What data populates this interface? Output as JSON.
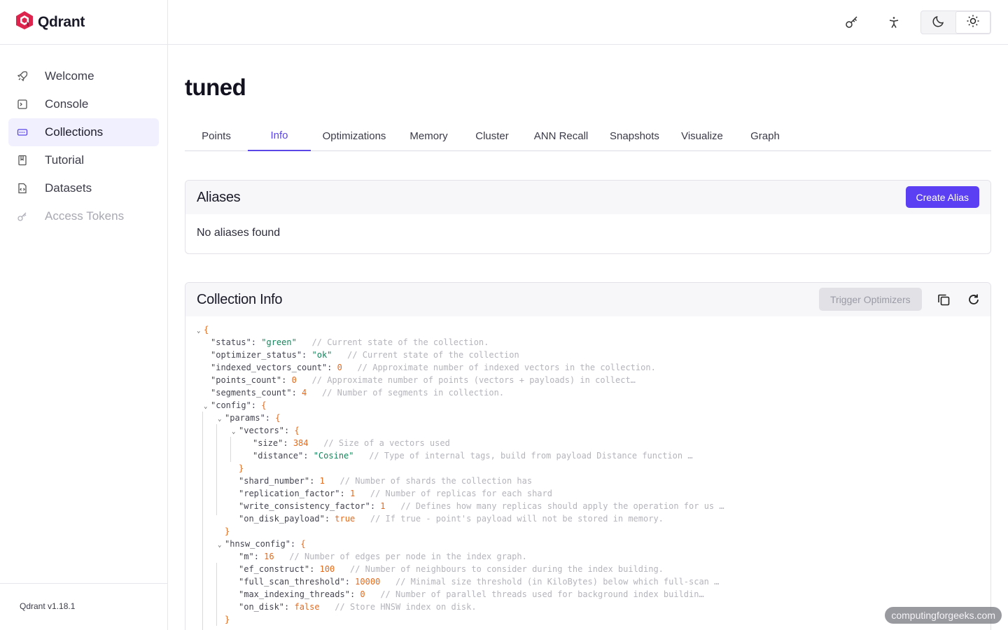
{
  "brand": {
    "name": "Qdrant",
    "accent": "#dc244c"
  },
  "sidebar": {
    "items": [
      {
        "label": "Welcome",
        "icon": "rocket-icon"
      },
      {
        "label": "Console",
        "icon": "terminal-icon"
      },
      {
        "label": "Collections",
        "icon": "collections-icon",
        "active": true
      },
      {
        "label": "Tutorial",
        "icon": "book-icon"
      },
      {
        "label": "Datasets",
        "icon": "dataset-file-icon"
      },
      {
        "label": "Access Tokens",
        "icon": "key-icon",
        "disabled": true
      }
    ],
    "version": "Qdrant v1.18.1"
  },
  "topbar": {
    "icons": [
      "key-icon",
      "accessibility-icon"
    ],
    "theme": {
      "options": [
        "moon-icon",
        "sun-icon"
      ],
      "selected": "light"
    }
  },
  "page": {
    "title": "tuned"
  },
  "tabs": [
    {
      "label": "Points"
    },
    {
      "label": "Info",
      "active": true
    },
    {
      "label": "Optimizations"
    },
    {
      "label": "Memory"
    },
    {
      "label": "Cluster"
    },
    {
      "label": "ANN Recall"
    },
    {
      "label": "Snapshots"
    },
    {
      "label": "Visualize"
    },
    {
      "label": "Graph"
    }
  ],
  "aliases": {
    "title": "Aliases",
    "create_label": "Create Alias",
    "empty_text": "No aliases found"
  },
  "collection_info": {
    "title": "Collection Info",
    "trigger_label": "Trigger Optimizers",
    "json_lines": [
      {
        "depth": 0,
        "caret": true,
        "open": "{"
      },
      {
        "depth": 1,
        "key": "\"status\"",
        "value": "\"green\"",
        "type": "string",
        "comment": "// Current state of the collection."
      },
      {
        "depth": 1,
        "key": "\"optimizer_status\"",
        "value": "\"ok\"",
        "type": "string",
        "comment": "// Current state of the collection"
      },
      {
        "depth": 1,
        "key": "\"indexed_vectors_count\"",
        "value": "0",
        "type": "number",
        "comment": "// Approximate number of indexed vectors in the collection."
      },
      {
        "depth": 1,
        "key": "\"points_count\"",
        "value": "0",
        "type": "number",
        "comment": "// Approximate number of points (vectors + payloads) in collect…"
      },
      {
        "depth": 1,
        "key": "\"segments_count\"",
        "value": "4",
        "type": "number",
        "comment": "// Number of segments in collection."
      },
      {
        "depth": 1,
        "caret": true,
        "key": "\"config\"",
        "open": "{"
      },
      {
        "depth": 2,
        "caret": true,
        "key": "\"params\"",
        "open": "{"
      },
      {
        "depth": 3,
        "caret": true,
        "key": "\"vectors\"",
        "open": "{"
      },
      {
        "depth": 4,
        "key": "\"size\"",
        "value": "384",
        "type": "number",
        "comment": "// Size of a vectors used"
      },
      {
        "depth": 4,
        "key": "\"distance\"",
        "value": "\"Cosine\"",
        "type": "string",
        "comment": "// Type of internal tags, build from payload Distance function …"
      },
      {
        "depth": 3,
        "close": "}"
      },
      {
        "depth": 3,
        "key": "\"shard_number\"",
        "value": "1",
        "type": "number",
        "comment": "// Number of shards the collection has"
      },
      {
        "depth": 3,
        "key": "\"replication_factor\"",
        "value": "1",
        "type": "number",
        "comment": "// Number of replicas for each shard"
      },
      {
        "depth": 3,
        "key": "\"write_consistency_factor\"",
        "value": "1",
        "type": "number",
        "comment": "// Defines how many replicas should apply the operation for us …"
      },
      {
        "depth": 3,
        "key": "\"on_disk_payload\"",
        "value": "true",
        "type": "bool",
        "comment": "// If true - point's payload will not be stored in memory."
      },
      {
        "depth": 2,
        "close": "}"
      },
      {
        "depth": 2,
        "caret": true,
        "key": "\"hnsw_config\"",
        "open": "{"
      },
      {
        "depth": 3,
        "key": "\"m\"",
        "value": "16",
        "type": "number",
        "comment": "// Number of edges per node in the index graph."
      },
      {
        "depth": 3,
        "key": "\"ef_construct\"",
        "value": "100",
        "type": "number",
        "comment": "// Number of neighbours to consider during the index building."
      },
      {
        "depth": 3,
        "key": "\"full_scan_threshold\"",
        "value": "10000",
        "type": "number",
        "comment": "// Minimal size threshold (in KiloBytes) below which full-scan …"
      },
      {
        "depth": 3,
        "key": "\"max_indexing_threads\"",
        "value": "0",
        "type": "number",
        "comment": "// Number of parallel threads used for background index buildin…"
      },
      {
        "depth": 3,
        "key": "\"on_disk\"",
        "value": "false",
        "type": "bool",
        "comment": "// Store HNSW index on disk."
      },
      {
        "depth": 2,
        "close": "}"
      }
    ]
  },
  "watermark": "computingforgeeks.com"
}
